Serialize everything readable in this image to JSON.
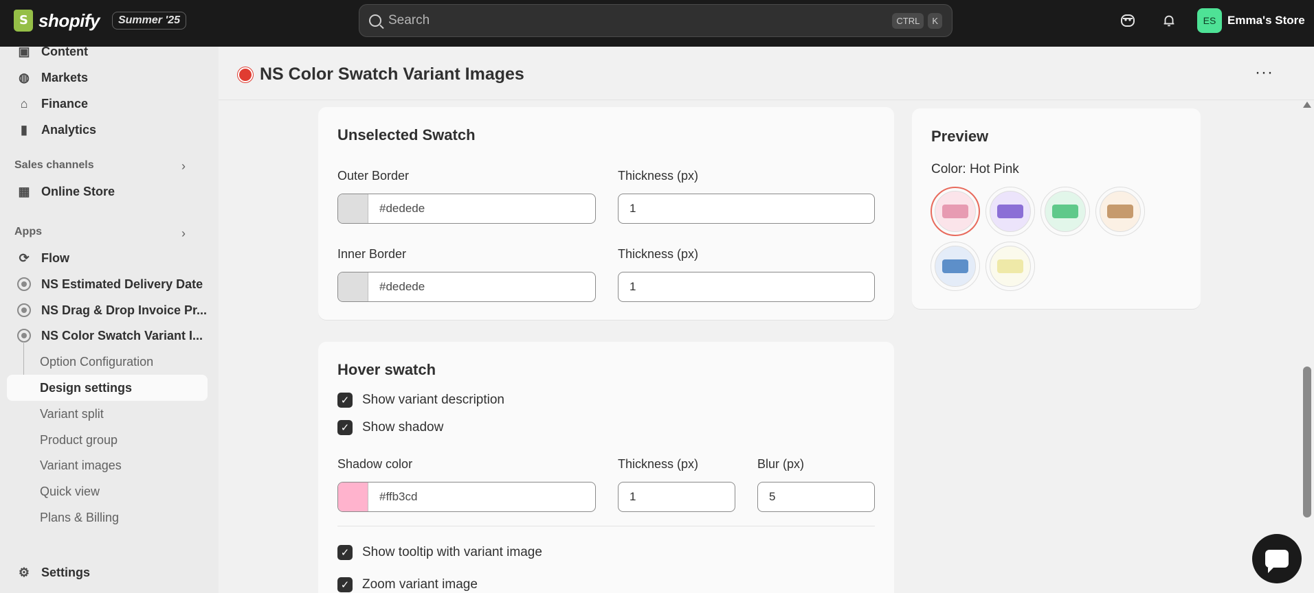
{
  "topbar": {
    "logo_text": "shopify",
    "edition": "Summer '25",
    "search_placeholder": "Search",
    "kbd_ctrl": "CTRL",
    "kbd_k": "K",
    "store_initials": "ES",
    "store_name": "Emma's Store"
  },
  "sidebar": {
    "top_items": [
      {
        "label": "Content",
        "icon": "content-icon"
      },
      {
        "label": "Markets",
        "icon": "globe-icon"
      },
      {
        "label": "Finance",
        "icon": "bank-icon"
      },
      {
        "label": "Analytics",
        "icon": "chart-bar-icon"
      }
    ],
    "sales_channels_heading": "Sales channels",
    "online_store": "Online Store",
    "apps_heading": "Apps",
    "apps": [
      {
        "label": "Flow"
      },
      {
        "label": "NS Estimated Delivery Date"
      },
      {
        "label": "NS Drag & Drop Invoice Pr..."
      },
      {
        "label": "NS Color Swatch Variant I..."
      }
    ],
    "sub_items": [
      {
        "label": "Option Configuration"
      },
      {
        "label": "Design settings"
      },
      {
        "label": "Variant split"
      },
      {
        "label": "Product group"
      },
      {
        "label": "Variant images"
      },
      {
        "label": "Quick view"
      },
      {
        "label": "Plans & Billing"
      }
    ],
    "settings": "Settings"
  },
  "page": {
    "title": "NS Color Swatch Variant Images",
    "more": "···"
  },
  "unselected": {
    "title": "Unselected Swatch",
    "outer_label": "Outer Border",
    "outer_color": "#dedede",
    "outer_thickness_label": "Thickness (px)",
    "outer_thickness": "1",
    "inner_label": "Inner Border",
    "inner_color": "#dedede",
    "inner_thickness_label": "Thickness (px)",
    "inner_thickness": "1"
  },
  "hover": {
    "title": "Hover swatch",
    "show_description": "Show variant description",
    "show_shadow": "Show shadow",
    "shadow_color_label": "Shadow color",
    "shadow_color": "#ffb3cd",
    "thickness_label": "Thickness (px)",
    "thickness": "1",
    "blur_label": "Blur (px)",
    "blur": "5",
    "show_tooltip": "Show tooltip with variant image",
    "zoom_image": "Zoom variant image"
  },
  "preview": {
    "title": "Preview",
    "color_text": "Color: Hot Pink",
    "swatches": [
      "#e79bb2",
      "#8b6fd6",
      "#5fc98a",
      "#c69a6d",
      "#5d8fc9",
      "#efe9a8"
    ],
    "swatch_backgrounds": [
      "#fbe4ea",
      "#ece4fb",
      "#e2f6ea",
      "#fbf0e4",
      "#e4ecf8",
      "#fbfaec"
    ]
  }
}
